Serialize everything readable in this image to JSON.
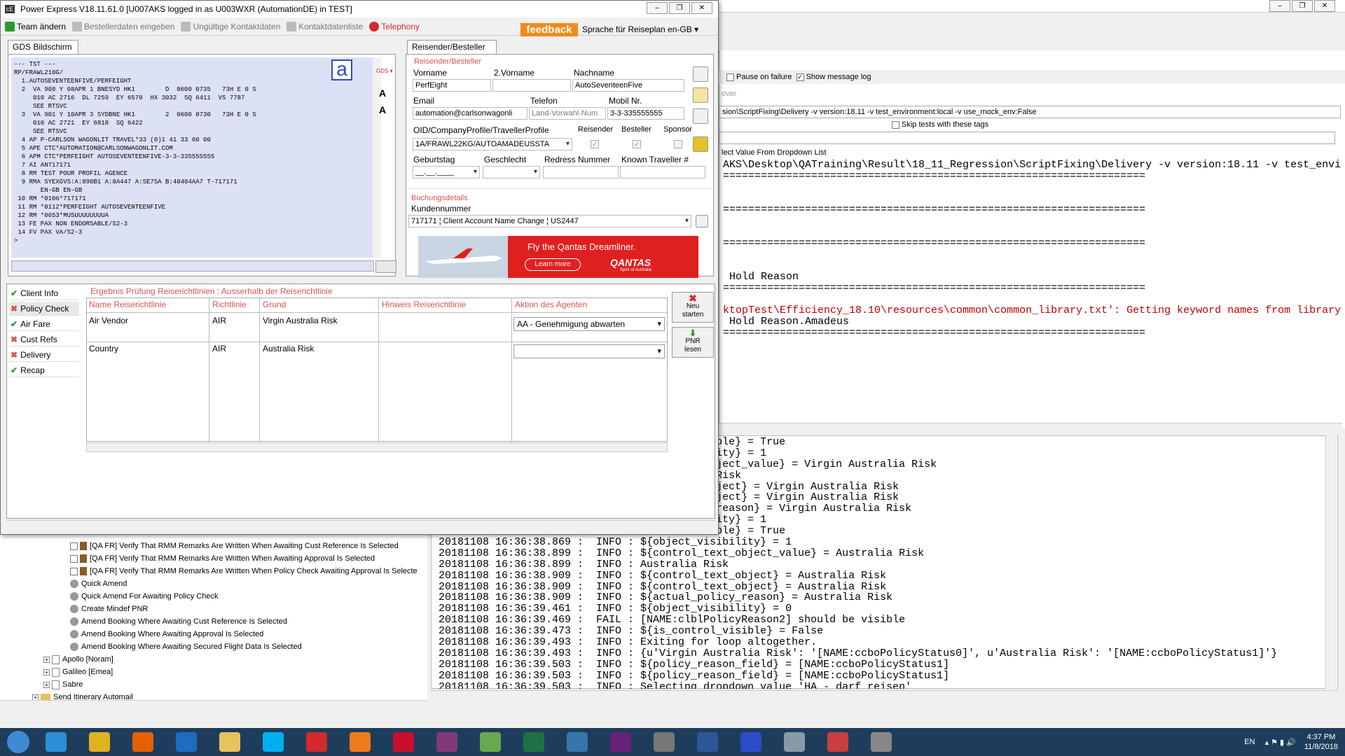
{
  "background_window": {
    "run_options": {
      "pause_on_failure": "Pause on failure",
      "show_message_log": "Show message log"
    },
    "hover_text": "over",
    "arguments": "sion\\ScriptFixing\\Delivery -v version:18.11 -v test_environment:local -v use_mock_env:False",
    "skip_tests": "Skip tests with these tags",
    "keyword_line": "lect Value From Dropdown List",
    "log_top": [
      {
        "text": "AKS\\Desktop\\QATraining\\Result\\18_11_Regression\\ScriptFixing\\Delivery -v version:18.11 -v test_envir",
        "cls": ""
      },
      {
        "text": "===================================================================",
        "cls": ""
      },
      {
        "text": "",
        "cls": ""
      },
      {
        "text": "",
        "cls": ""
      },
      {
        "text": "===================================================================",
        "cls": ""
      },
      {
        "text": "",
        "cls": ""
      },
      {
        "text": "",
        "cls": ""
      },
      {
        "text": "===================================================================",
        "cls": ""
      },
      {
        "text": "",
        "cls": ""
      },
      {
        "text": "",
        "cls": ""
      },
      {
        "text": " Hold Reason",
        "cls": ""
      },
      {
        "text": "===================================================================",
        "cls": ""
      },
      {
        "text": "",
        "cls": ""
      },
      {
        "text": "ktopTest\\Efficiency_18.10\\resources\\common\\common_library.txt': Getting keyword names from library",
        "cls": "red"
      },
      {
        "text": " Hold Reason.Amadeus",
        "cls": ""
      },
      {
        "text": "===================================================================",
        "cls": ""
      }
    ],
    "log_bottom": [
      "                                        visible} = True",
      "                                        ibility} = 1",
      "                                        t_object_value} = Virgin Australia Risk",
      "                                        lia Risk",
      "                                        t_object} = Virgin Australia Risk",
      "                                        t_object} = Virgin Australia Risk",
      "                                        icy_reason} = Virgin Australia Risk",
      "                                        ibility} = 1",
      "                                        visible} = True",
      "20181108 16:36:38.869 :  INFO : ${object_visibility} = 1",
      "20181108 16:36:38.899 :  INFO : ${control_text_object_value} = Australia Risk",
      "20181108 16:36:38.899 :  INFO : Australia Risk",
      "20181108 16:36:38.909 :  INFO : ${control_text_object} = Australia Risk",
      "20181108 16:36:38.909 :  INFO : ${control_text_object} = Australia Risk",
      "20181108 16:36:38.909 :  INFO : ${actual_policy_reason} = Australia Risk",
      "20181108 16:36:39.461 :  INFO : ${object_visibility} = 0",
      "20181108 16:36:39.469 :  FAIL : [NAME:clblPolicyReason2] should be visible",
      "20181108 16:36:39.473 :  INFO : ${is_control_visible} = False",
      "20181108 16:36:39.493 :  INFO : Exiting for loop altogether.",
      "20181108 16:36:39.493 :  INFO : {u'Virgin Australia Risk': '[NAME:ccboPolicyStatus0]', u'Australia Risk': '[NAME:ccboPolicyStatus1]'}",
      "20181108 16:36:39.503 :  INFO : ${policy_reason_field} = [NAME:ccboPolicyStatus1]",
      "20181108 16:36:39.503 :  INFO : ${policy_reason_field} = [NAME:ccboPolicyStatus1]",
      "20181108 16:36:39.503 :  INFO : Selecting dropdown value 'HA - darf reisen'"
    ],
    "tree": [
      {
        "text": "[QA FR] Verify That RMM Remarks Are Written When Awaiting Cust Reference Is Selected",
        "kind": "test"
      },
      {
        "text": "[QA FR] Verify That RMM Remarks Are Written When Awaiting Approval Is Selected",
        "kind": "test"
      },
      {
        "text": "[QA FR] Verify That RMM Remarks Are Written When Policy Check Awaiting Approval Is Selecte",
        "kind": "test"
      },
      {
        "text": "Quick Amend",
        "kind": "kw"
      },
      {
        "text": "Quick Amend For Awaiting Policy Check",
        "kind": "kw"
      },
      {
        "text": "Create Mindef PNR",
        "kind": "kw"
      },
      {
        "text": "Amend Booking Where Awaiting Cust Reference Is Selected",
        "kind": "kw"
      },
      {
        "text": "Amend Booking Where Awaiting Approval Is Selected",
        "kind": "kw"
      },
      {
        "text": "Amend Booking Where Awaiting Secured Flight Data Is Selected",
        "kind": "kw"
      },
      {
        "text": "Apollo [Noram]",
        "kind": "doc"
      },
      {
        "text": "Galileo [Emea]",
        "kind": "doc"
      },
      {
        "text": "Sabre",
        "kind": "doc"
      },
      {
        "text": "Send Itinerary Automail",
        "kind": "folder"
      }
    ]
  },
  "app": {
    "title": "Power Express V18.11.61.0  [U007AKS logged in as U003WXR (AutomationDE) in TEST]",
    "toolbar": {
      "team": "Team ändern",
      "besteller": "Bestellerdaten eingeben",
      "ungueltig": "Ungültige Kontaktdaten",
      "kontaktliste": "Kontaktdatenliste",
      "telephony": "Telephony",
      "feedback": "feedback",
      "sprache": "Sprache für Reiseplan en-GB"
    },
    "gds": {
      "tab": "GDS Bildschirm",
      "logo_letter": "a",
      "font_up": "A",
      "font_down": "A",
      "gds_label": "GDS",
      "screen": "--- TST ---\nRP/FRAWL210G/\n  1.AUTOSEVENTEENFIVE/PERFEIGHT\n  2  VA 908 Y 08APR 1 BNESYD HK1        D  0600 0735   73H E 0 S\n     010 AC 2716  DL 7259  EY 6570  HX 3032  SQ 6411  VS 7787\n     SEE RTSVC\n  3  VA 901 Y 10APR 3 SYDBNE HK1        2  0600 0730   73H E 0 S\n     010 AC 2721  EY 6818  SQ 6422\n     SEE RTSVC\n  4 AP P-CARLSON WAGONLIT TRAVEL*33 (0)1 41 33 60 00\n  5 APE CTC*AUTOMATION@CARLSONWAGONLIT.COM\n  6 APM CTC*PERFEIGHT AUTOSEVENTEENFIVE-3-3-335555555\n  7 AI AN717171\n  8 RM TEST POUR PROFIL AGENCE\n  9 RMA SYEXGVS:A:890B1 A:8A447 A:SE7SA B:40404AA7 T-717171\n       EN-GB EN-GB\n 10 RM *0106*717171\n 11 RM *0112*PERFEIGHT AUTOSEVENTEENFIVE\n 12 RM *0653*MUSUUUUUUUUA\n 13 FE PAX NON ENDORSABLE/S2-3\n 14 FV PAX VA/S2-3\n>"
    },
    "reisender": {
      "tab": "Reisender/Besteller",
      "group": "Reisender/Besteller",
      "vorname_label": "Vorname",
      "vorname": "PerfEight",
      "vorname2_label": "2.Vorname",
      "vorname2": "",
      "nachname_label": "Nachname",
      "nachname": "AutoSeventeenFive",
      "email_label": "Email",
      "email": "automation@carlsonwagonli",
      "telefon_label": "Telefon",
      "telefon": "Land-Vorwahl-Num",
      "mobil_label": "Mobil Nr.",
      "mobil": "3-3-335555555",
      "oid_label": "OID/CompanyProfile/TravellerProfile",
      "oid": "1A/FRAWL22KG/AUTOAMADEUSSTA",
      "reisender_cb": "Reisender",
      "besteller_cb": "Besteller",
      "sponsor_cb": "Sponsor",
      "geburtstag_label": "Geburtstag",
      "geburtstag": "__.__.____",
      "geschlecht_label": "Geschlecht",
      "redress_label": "Redress Nummer",
      "known_label": "Known Traveller #",
      "buchung_group": "Buchungsdetails",
      "kundennummer_label": "Kundennummer",
      "kundennummer": "717171 ¦ Client Account Name Change ¦ US2447",
      "ad_text": "Fly the Qantas Dreamliner.",
      "ad_button": "Learn more",
      "ad_brand": "QANTAS",
      "ad_tagline": "Spirit of Australia"
    },
    "nav": [
      {
        "label": "Client Info",
        "status": "ok"
      },
      {
        "label": "Policy Check",
        "status": "err"
      },
      {
        "label": "Air Fare",
        "status": "ok"
      },
      {
        "label": "Cust Refs",
        "status": "err"
      },
      {
        "label": "Delivery",
        "status": "err"
      },
      {
        "label": "Recap",
        "status": "ok"
      }
    ],
    "policy": {
      "title": "Ergebnis Prüfung Reiserichtlinien : Ausserhalb der Reiserichtlinie",
      "headers": [
        "Name Reiserichtlinie",
        "Richtlinie",
        "Grund",
        "Hinweis Reiserichtlinie",
        "Aktion des Agenten"
      ],
      "rows": [
        {
          "name": "Air Vendor",
          "richtlinie": "AIR",
          "grund": "Virgin Australia Risk",
          "hinweis": "",
          "aktion": "AA - Genehmigung abwarten"
        },
        {
          "name": "Country",
          "richtlinie": "AIR",
          "grund": "Australia Risk",
          "hinweis": "",
          "aktion": ""
        }
      ],
      "neu_starten_1": "Neu",
      "neu_starten_2": "starten",
      "pnr_lesen_1": "PNR",
      "pnr_lesen_2": "lesen"
    }
  },
  "taskbar": {
    "lang": "EN",
    "time": "4:37 PM",
    "date": "11/8/2018",
    "apps": [
      {
        "name": "ie-icon",
        "color": "#2b8fd6"
      },
      {
        "name": "chrome-icon",
        "color": "#e0b21f"
      },
      {
        "name": "firefox-icon",
        "color": "#e66000"
      },
      {
        "name": "outlook-icon",
        "color": "#1f6cc0"
      },
      {
        "name": "explorer-icon",
        "color": "#e8c25a"
      },
      {
        "name": "skype-icon",
        "color": "#00aff0"
      },
      {
        "name": "app-red-icon",
        "color": "#d22b2b"
      },
      {
        "name": "media-icon",
        "color": "#f07a1a"
      },
      {
        "name": "rsa-icon",
        "color": "#c8102e"
      },
      {
        "name": "onenote-icon",
        "color": "#80397b"
      },
      {
        "name": "chart-app-icon",
        "color": "#6aa84f"
      },
      {
        "name": "excel-icon",
        "color": "#1e7145"
      },
      {
        "name": "python-icon",
        "color": "#3776ab"
      },
      {
        "name": "visualstudio-icon",
        "color": "#68217a"
      },
      {
        "name": "tools-icon",
        "color": "#777777"
      },
      {
        "name": "word-icon",
        "color": "#2b5797"
      },
      {
        "name": "amadeus-icon",
        "color": "#2b4cc9"
      },
      {
        "name": "app-gray-icon",
        "color": "#8899aa"
      },
      {
        "name": "snipping-icon",
        "color": "#c94040"
      },
      {
        "name": "settings-icon",
        "color": "#888888"
      }
    ]
  }
}
